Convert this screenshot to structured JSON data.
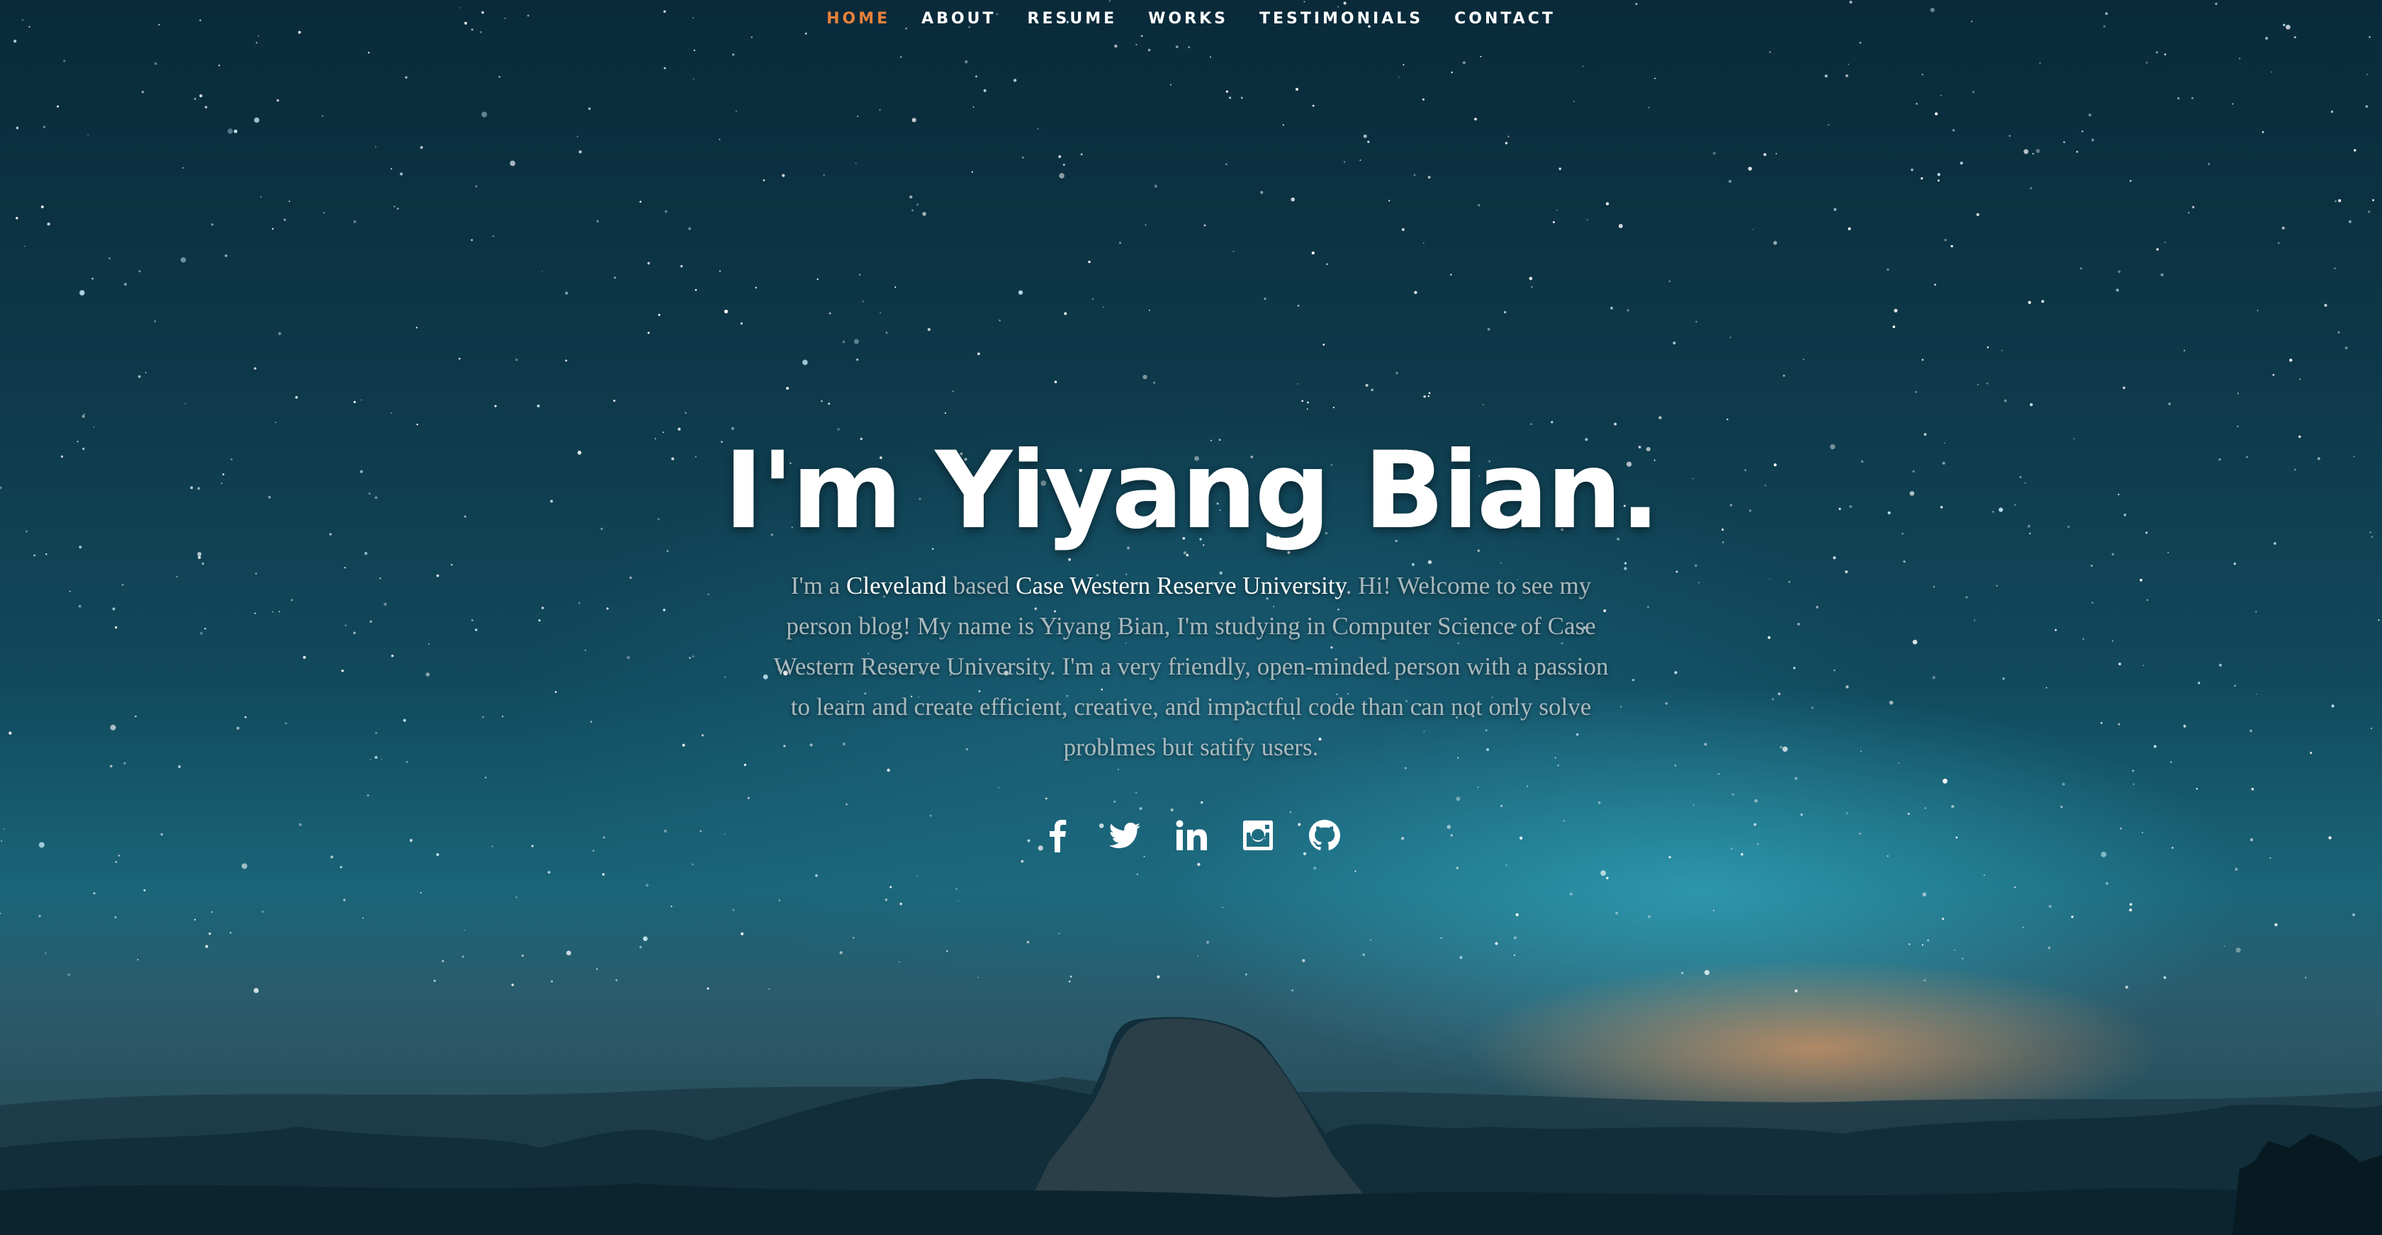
{
  "nav": {
    "items": [
      {
        "label": "HOME",
        "active": true
      },
      {
        "label": "ABOUT"
      },
      {
        "label": "RESUME"
      },
      {
        "label": "WORKS"
      },
      {
        "label": "TESTIMONIALS"
      },
      {
        "label": "CONTACT"
      }
    ],
    "active_color": "#e8813a"
  },
  "hero": {
    "title": "I'm Yiyang Bian.",
    "intro_prefix": "I'm a ",
    "city": "Cleveland",
    "intro_mid": " based ",
    "university": "Case Western Reserve University",
    "intro_rest": ". Hi! Welcome to see my person blog! My name is Yiyang Bian, I'm studying in Computer Science of Case Western Reserve University. I'm a very friendly, open-minded person with a passion to learn and create efficient, creative, and impactful code than can not only solve problmes but satify users."
  },
  "social": {
    "icons": [
      "facebook-icon",
      "twitter-icon",
      "linkedin-icon",
      "instagram-icon",
      "github-icon"
    ]
  }
}
